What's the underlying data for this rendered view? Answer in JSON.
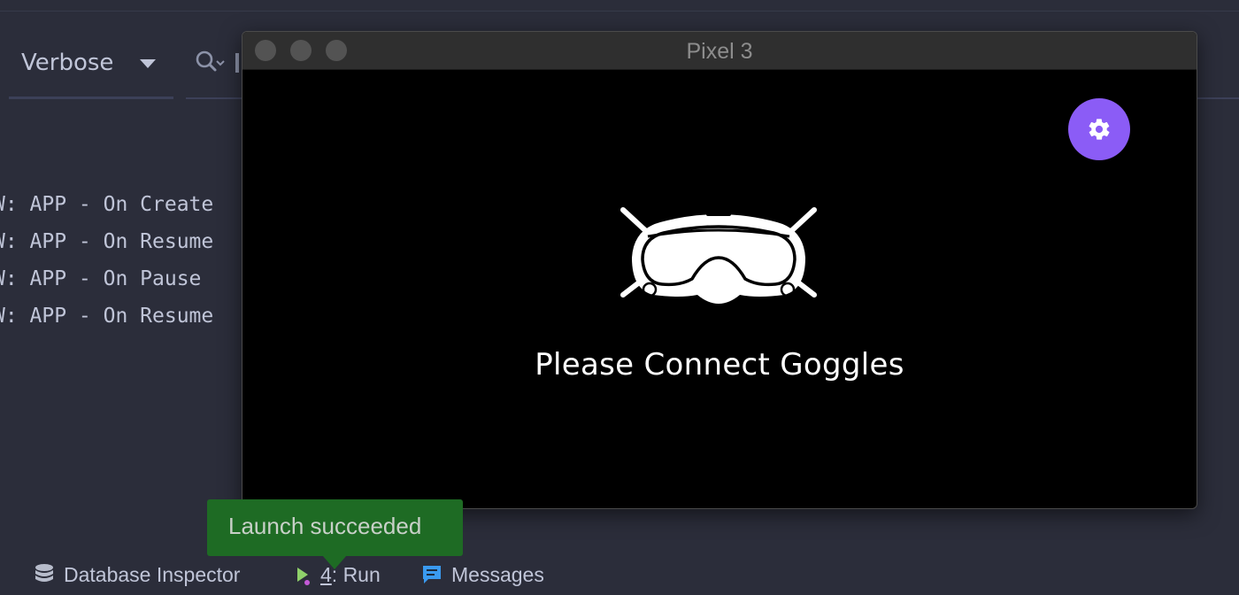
{
  "logcat": {
    "level": "Verbose",
    "lines": [
      "W: APP - On Create",
      "W: APP - On Resume",
      "W: APP - On Pause",
      "W: APP - On Resume"
    ]
  },
  "emulator": {
    "title": "Pixel 3",
    "message": "Please Connect Goggles",
    "accent_color": "#8b5cf6"
  },
  "toast": {
    "text": "Launch succeeded",
    "color": "#1e6b24"
  },
  "toolbar": {
    "database_inspector": "Database Inspector",
    "run_number": "4",
    "run_label": ": Run",
    "messages": "Messages"
  },
  "icons": {
    "database": "database-icon",
    "run": "run-icon",
    "messages": "messages-icon",
    "search": "search-icon",
    "settings": "gear-icon",
    "goggles": "goggles-icon"
  }
}
